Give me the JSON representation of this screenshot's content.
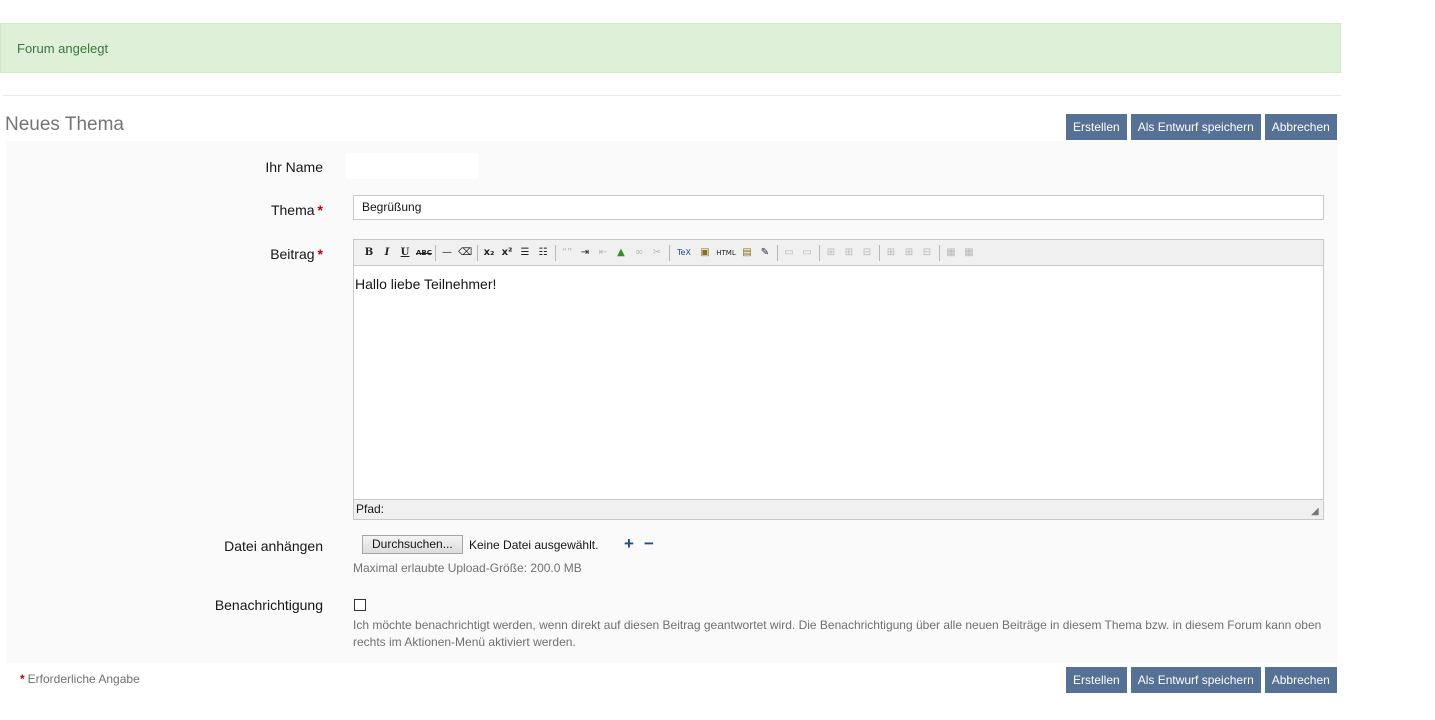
{
  "message": {
    "success": "Forum angelegt"
  },
  "page": {
    "title": "Neues Thema"
  },
  "buttons": {
    "create": "Erstellen",
    "save_draft": "Als Entwurf speichern",
    "cancel": "Abbrechen"
  },
  "form": {
    "name_label": "Ihr Name",
    "name_value": "",
    "thema_label": "Thema",
    "thema_value": "Begrüßung",
    "required_marker": "*",
    "beitrag_label": "Beitrag",
    "beitrag_text": "Hallo liebe Teilnehmer!",
    "editor_path_label": "Pfad:",
    "attach_label": "Datei anhängen",
    "browse_button": "Durchsuchen...",
    "no_file": "Keine Datei ausgewählt.",
    "upload_limit": "Maximal erlaubte Upload-Größe: 200.0 MB",
    "notify_label": "Benachrichtigung",
    "notify_checked": false,
    "notify_info": "Ich möchte benachrichtigt werden, wenn direkt auf diesen Beitrag geantwortet wird. Die Benachrichtigung über alle neuen Beiträge in diesem Thema bzw. in diesem Forum kann oben rechts im Aktionen-Menü aktiviert werden.",
    "required_note": "Erforderliche Angabe"
  },
  "toolbar_icons": [
    "bold-icon",
    "italic-icon",
    "underline-icon",
    "strikethrough-icon",
    "horizontal-rule-icon",
    "eraser-icon",
    "subscript-icon",
    "superscript-icon",
    "bullet-list-icon",
    "numbered-list-icon",
    "blockquote-icon",
    "indent-icon",
    "outdent-icon",
    "image-icon",
    "link-icon",
    "unlink-icon",
    "tex-icon",
    "paste-icon",
    "html-icon",
    "paste-word-icon",
    "edit-icon",
    "table-icons"
  ],
  "colors": {
    "success_bg": "#dff0d8",
    "success_text": "#3c763d",
    "button_bg": "#557196",
    "required": "#c00000"
  }
}
